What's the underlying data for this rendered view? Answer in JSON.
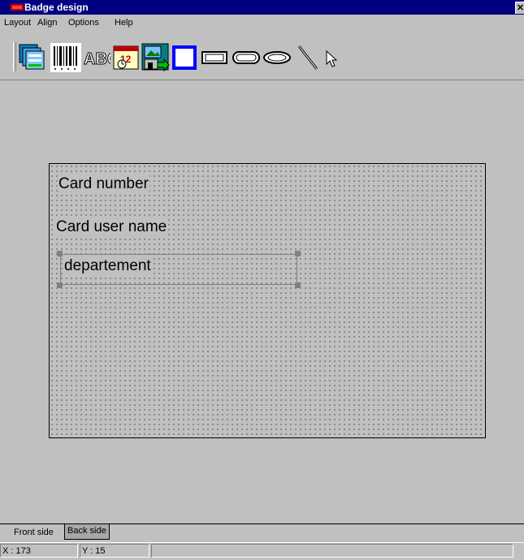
{
  "window": {
    "title": "Badge design",
    "close_glyph": "✕"
  },
  "menu": {
    "items": [
      "Layout",
      "Align",
      "Options",
      "Help"
    ]
  },
  "toolbar": {
    "tools": [
      "layers-icon",
      "barcode-icon",
      "text-abc-icon",
      "date-time-icon",
      "image-import-icon",
      "rectangle-thick-icon",
      "rectangle-icon",
      "rounded-rectangle-icon",
      "ellipse-icon",
      "line-icon",
      "pointer-icon"
    ]
  },
  "card": {
    "fields": {
      "card_number": "Card number",
      "card_user_name": "Card user name",
      "department": "departement"
    }
  },
  "tabs": {
    "front": "Front side",
    "back": "Back side"
  },
  "status": {
    "x": "X : 173",
    "y": "Y : 15"
  },
  "colors": {
    "title_bar": "#000080",
    "background": "#c0c0c0",
    "accent_blue": "#0000ff"
  }
}
